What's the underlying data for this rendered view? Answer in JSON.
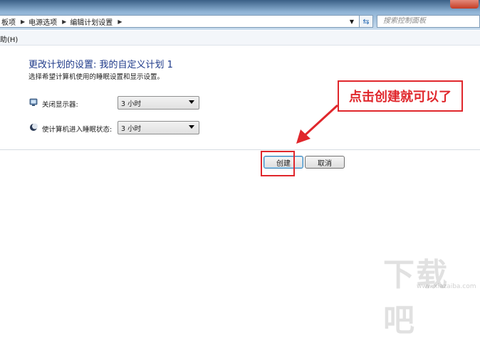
{
  "address_bar": {
    "crumbs": [
      "板项",
      "电源选项",
      "编辑计划设置"
    ],
    "search_placeholder": "搜索控制面板"
  },
  "menu": {
    "help": "助(H)"
  },
  "header": {
    "title": "更改计划的设置: 我的自定义计划 1",
    "subtitle": "选择希望计算机使用的睡眠设置和显示设置。"
  },
  "settings": [
    {
      "icon": "monitor-icon",
      "label": "关闭显示器:",
      "value": "3 小时"
    },
    {
      "icon": "moon-icon",
      "label": "使计算机进入睡眠状态:",
      "value": "3 小时"
    }
  ],
  "buttons": {
    "create": "创建",
    "cancel": "取消"
  },
  "annotation": {
    "text": "点击创建就可以了",
    "color": "#e0272c"
  },
  "watermark": {
    "text": "下载吧",
    "url": "www.xiazaiba.com"
  }
}
